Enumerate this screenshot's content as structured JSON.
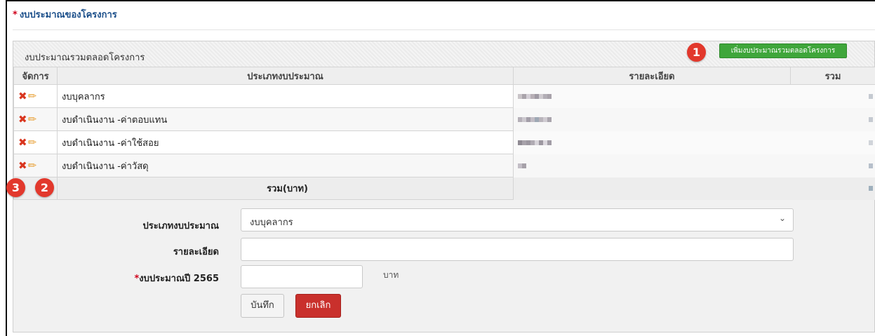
{
  "section": {
    "required_mark": "*",
    "title": "งบประมาณของโครงการ"
  },
  "panel": {
    "title": "งบประมาณรวมตลอดโครงการ",
    "add_button": "เพิ่มงบประมาณรวมตลอดโครงการ"
  },
  "markers": [
    "1",
    "2",
    "3"
  ],
  "table": {
    "headers": [
      "จัดการ",
      "ประเภทงบประมาณ",
      "รายละเอียด",
      "รวม"
    ],
    "rows": [
      {
        "type": "งบบุคลากร",
        "detail": "",
        "total": ""
      },
      {
        "type": "งบดำเนินงาน -ค่าตอบแทน",
        "detail": "",
        "total": ""
      },
      {
        "type": "งบดำเนินงาน -ค่าใช้สอย",
        "detail": "",
        "total": ""
      },
      {
        "type": "งบดำเนินงาน -ค่าวัสดุ",
        "detail": "",
        "total": ""
      }
    ],
    "total_label": "รวม(บาท)"
  },
  "icons": {
    "delete": "x-icon",
    "edit": "pencil-icon",
    "dropdown": "chevron-down-icon"
  },
  "form": {
    "budget_type_label": "ประเภทงบประมาณ",
    "budget_type_value": "งบบุคลากร",
    "detail_label": "รายละเอียด",
    "detail_value": "",
    "amount_required_mark": "*",
    "amount_label": "งบประมาณปี 2565",
    "amount_value": "",
    "unit": "บาท",
    "save_button": "บันทึก",
    "cancel_button": "ยกเลิก"
  },
  "colors": {
    "accent_green": "#3fa63b",
    "marker_red": "#e2382c",
    "cancel_red": "#c9302c",
    "title_blue": "#1b4f8a"
  }
}
